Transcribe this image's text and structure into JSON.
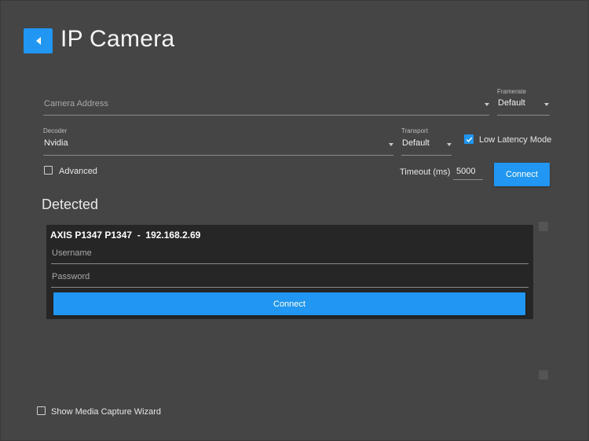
{
  "header": {
    "title": "IP Camera"
  },
  "settings": {
    "camera_address_placeholder": "Camera Address",
    "framerate_label": "Framerate",
    "framerate_value": "Default",
    "decoder_label": "Decoder",
    "decoder_value": "Nvidia",
    "transport_label": "Transport",
    "transport_value": "Default",
    "low_latency_label": "Low Latency Mode",
    "low_latency_checked": true,
    "advanced_label": "Advanced",
    "advanced_checked": false,
    "timeout_label": "Timeout (ms)",
    "timeout_value": "5000",
    "connect_label": "Connect"
  },
  "detected": {
    "title": "Detected",
    "devices": [
      {
        "name": "AXIS P1347 P1347  -  192.168.2.69",
        "username_placeholder": "Username",
        "password_placeholder": "Password",
        "connect_label": "Connect"
      }
    ]
  },
  "footer": {
    "show_wizard_label": "Show Media Capture Wizard",
    "show_wizard_checked": false
  },
  "colors": {
    "accent": "#2196f3",
    "background": "#454545",
    "card": "#262626"
  }
}
